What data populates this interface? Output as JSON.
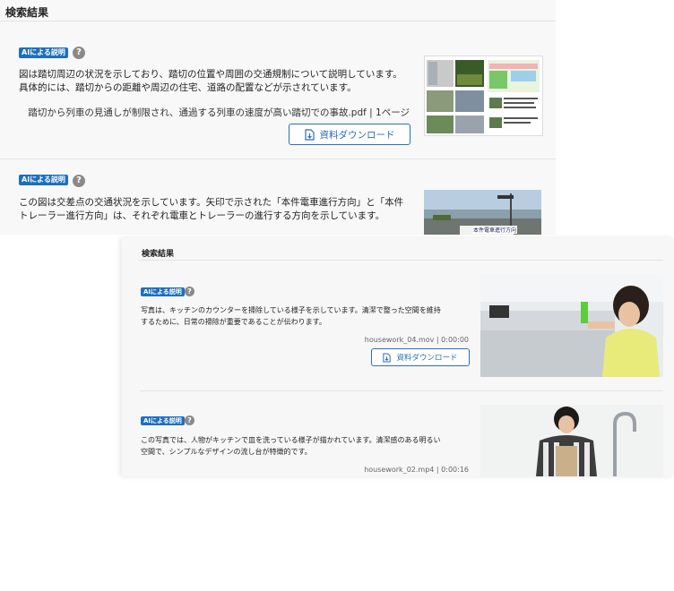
{
  "panel_top": {
    "title": "検索結果",
    "results": [
      {
        "badge": "AIによる説明",
        "description_lines": [
          "図は踏切周辺の状況を示しており、踏切の位置や周囲の交通規制について説明しています。",
          "具体的には、踏切からの距離や周辺の住宅、道路の配置などが示されています。"
        ],
        "meta": "踏切から列車の見通しが制限され、通過する列車の速度が高い踏切での事故.pdf | 1ページ",
        "download_label": "資料ダウンロード"
      },
      {
        "badge": "AIによる説明",
        "description_lines": [
          "この図は交差点の交通状況を示しています。矢印で示された「本件電車進行方向」と「本件",
          "トレーラー進行方向」は、それぞれ電車とトレーラーの進行する方向を示しています。"
        ],
        "thumb_caption": "本件電車進行方向"
      }
    ]
  },
  "panel_bottom": {
    "title": "検索結果",
    "results": [
      {
        "badge": "AIによる説明",
        "description_lines": [
          "写真は、キッチンのカウンターを掃除している様子を示しています。清潔で整った空間を維持",
          "するために、日常の掃除が重要であることが伝わります。"
        ],
        "meta": "housework_04.mov | 0:00:00",
        "download_label": "資料ダウンロード"
      },
      {
        "badge": "AIによる説明",
        "description_lines": [
          "この写真では、人物がキッチンで皿を洗っている様子が描かれています。清潔感のある明るい",
          "空間で、シンプルなデザインの流し台が特徴的です。"
        ],
        "meta": "housework_02.mp4 | 0:00:16"
      }
    ]
  },
  "icons": {
    "help": "question-circle-icon",
    "download": "download-file-icon"
  },
  "colors": {
    "badge": "#1e6fc0",
    "button_border": "#2b6fb8",
    "help_icon": "#8a8a8a"
  }
}
